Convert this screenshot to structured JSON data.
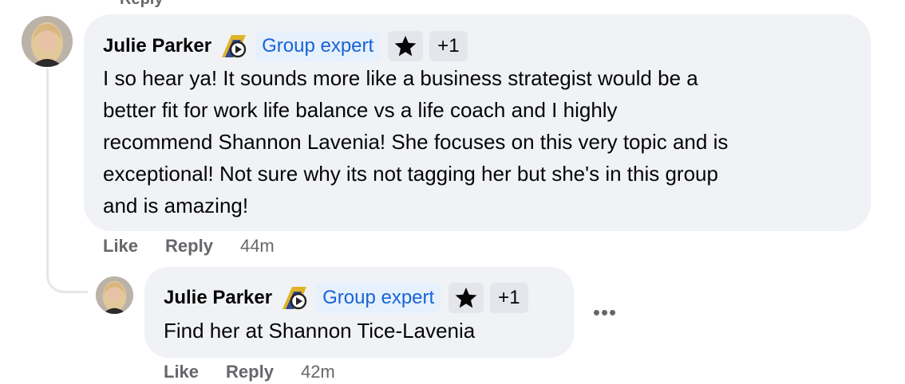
{
  "prev_cut": {
    "label": "Reply"
  },
  "comments": [
    {
      "author": "Julie Parker",
      "badge": "Group expert",
      "extra_badges": "+1",
      "text": "I so hear ya! It sounds more like a business strategist would be a\nbetter fit for work life balance vs a life coach and I highly\nrecommend Shannon Lavenia! She focuses on this very topic and is\nexceptional! Not sure why its not tagging her but she's in this group\nand is amazing!",
      "like": "Like",
      "reply": "Reply",
      "time": "44m"
    },
    {
      "author": "Julie Parker",
      "badge": "Group expert",
      "extra_badges": "+1",
      "text": "Find her at Shannon Tice-Lavenia",
      "like": "Like",
      "reply": "Reply",
      "time": "42m",
      "more": "•••"
    }
  ],
  "colors": {
    "bubble": "#f0f2f5",
    "expert_chip_bg": "#e7f0fd",
    "expert_chip_text": "#1664d6",
    "meta_text": "#65676b"
  },
  "icons": {
    "avatar": "profile-photo",
    "emblem": "community-emblem-icon",
    "star": "star-badge-icon",
    "more": "more-options-icon"
  }
}
